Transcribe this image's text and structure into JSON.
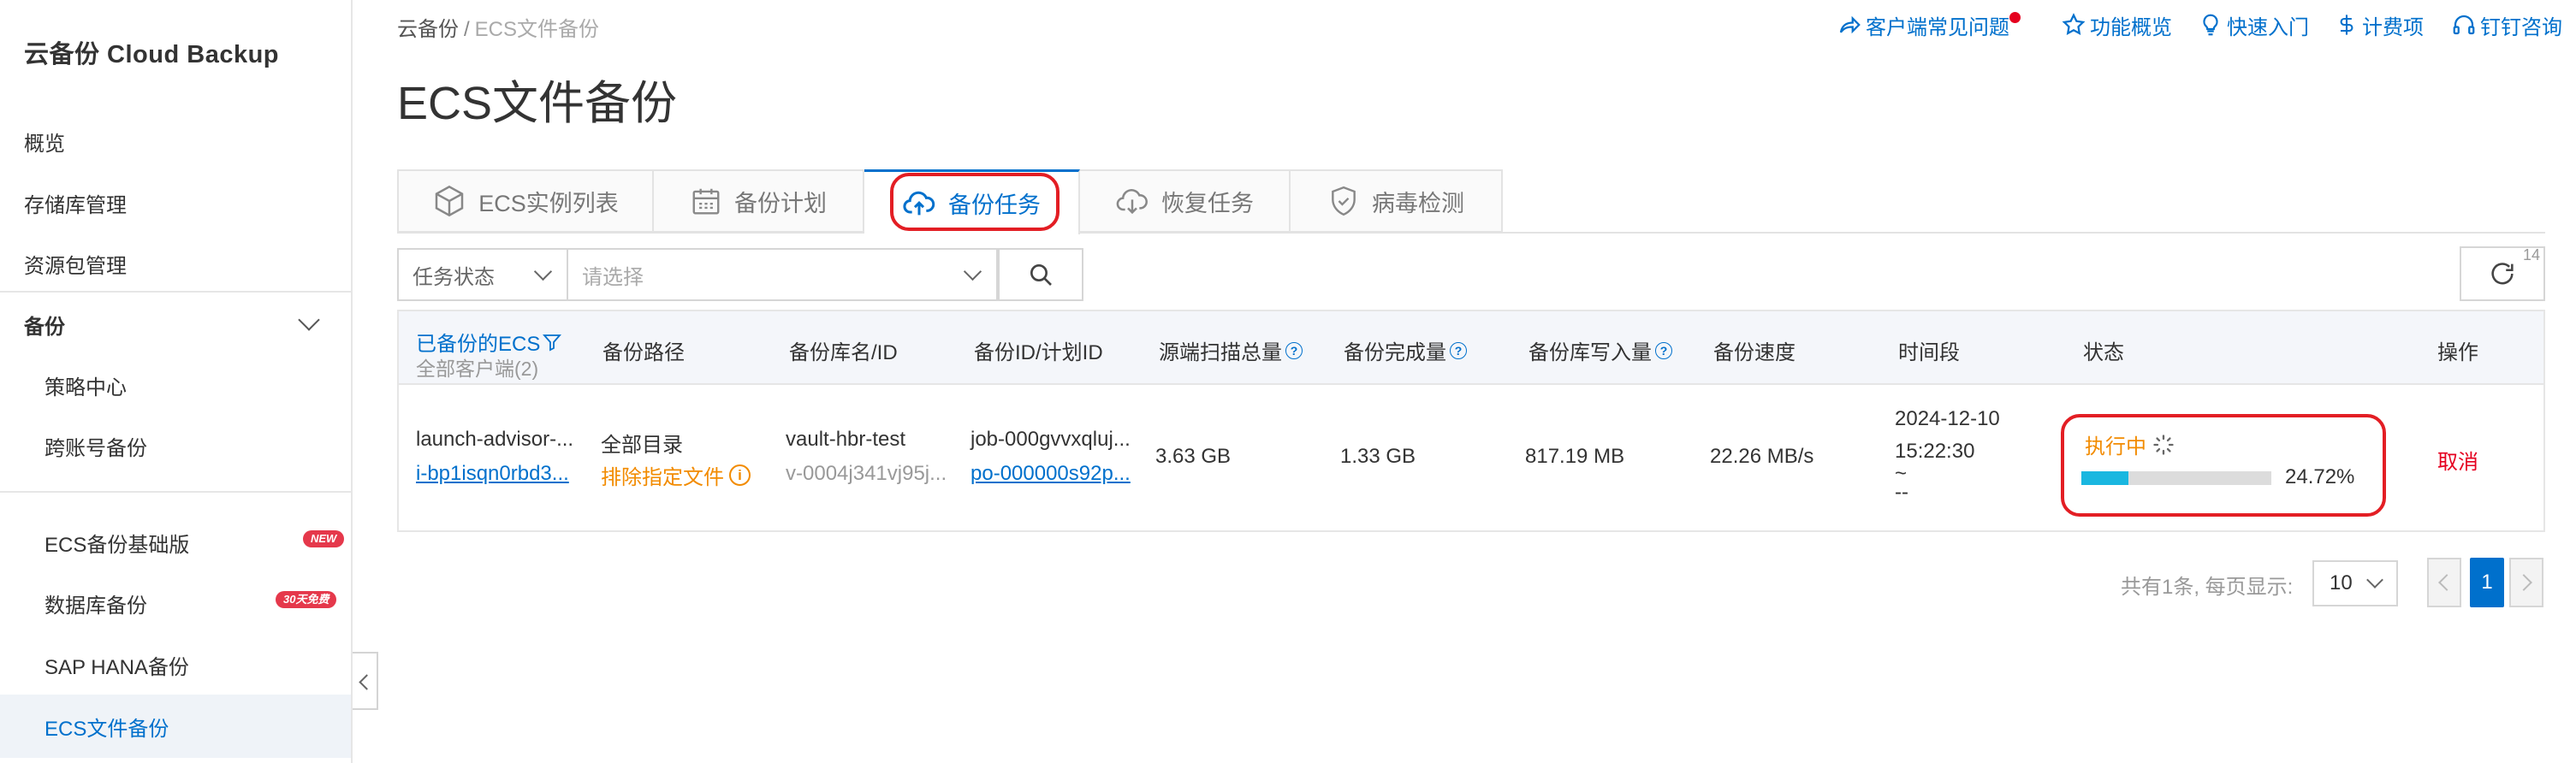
{
  "sidebar": {
    "brand": "云备份 Cloud Backup",
    "items": [
      {
        "label": "概览"
      },
      {
        "label": "存储库管理"
      },
      {
        "label": "资源包管理"
      }
    ],
    "group": {
      "label": "备份"
    },
    "sub_items": [
      {
        "label": "策略中心"
      },
      {
        "label": "跨账号备份"
      },
      {
        "label": "ECS备份基础版",
        "badge": "NEW"
      },
      {
        "label": "数据库备份",
        "badge": "30天免费"
      },
      {
        "label": "SAP HANA备份"
      },
      {
        "label": "ECS文件备份"
      }
    ]
  },
  "breadcrumb": {
    "root": "云备份",
    "sep": "/",
    "current": "ECS文件备份"
  },
  "page_title": "ECS文件备份",
  "header_links": [
    {
      "label": "客户端常见问题",
      "icon": "share-icon"
    },
    {
      "label": "功能概览",
      "icon": "star-icon"
    },
    {
      "label": "快速入门",
      "icon": "bulb-icon"
    },
    {
      "label": "计费项",
      "icon": "dollar-icon"
    },
    {
      "label": "钉钉咨询",
      "icon": "headset-icon"
    }
  ],
  "tabs": [
    {
      "label": "ECS实例列表",
      "icon": "cube-icon"
    },
    {
      "label": "备份计划",
      "icon": "calendar-icon"
    },
    {
      "label": "备份任务",
      "icon": "cloud-upload-icon"
    },
    {
      "label": "恢复任务",
      "icon": "cloud-download-icon"
    },
    {
      "label": "病毒检测",
      "icon": "shield-icon"
    }
  ],
  "active_tab": 2,
  "filter": {
    "field": "任务状态",
    "placeholder": "请选择"
  },
  "refresh": {
    "count": "14"
  },
  "table": {
    "columns": [
      "已备份的ECS",
      "备份路径",
      "备份库名/ID",
      "备份ID/计划ID",
      "源端扫描总量",
      "备份完成量",
      "备份库写入量",
      "备份速度",
      "时间段",
      "状态",
      "操作"
    ],
    "first_col_sub": "全部客户端(2)",
    "rows": [
      {
        "ecs_name": "launch-advisor-...",
        "ecs_id": "i-bp1isqn0rbd3...",
        "path": "全部目录",
        "path_exclude": "排除指定文件",
        "vault_name": "vault-hbr-test",
        "vault_id": "v-0004j341vj95j...",
        "job_id": "job-000gvvxqluj...",
        "plan_id": "po-000000s92p...",
        "scanned": "3.63 GB",
        "done": "1.33 GB",
        "written": "817.19 MB",
        "speed": "22.26 MB/s",
        "time_start": "2024-12-10",
        "time_clock": "15:22:30",
        "time_tilde": "~",
        "time_end": "--",
        "status": "执行中",
        "progress": 24.72,
        "progress_label": "24.72%",
        "action": "取消"
      }
    ]
  },
  "pagination": {
    "summary": "共有1条, 每页显示:",
    "page_size": "10",
    "current_page": "1"
  },
  "colors": {
    "accent": "#0070cc",
    "highlight": "#e31e24",
    "running": "#f28b00",
    "progress": "#1ab7e0"
  }
}
